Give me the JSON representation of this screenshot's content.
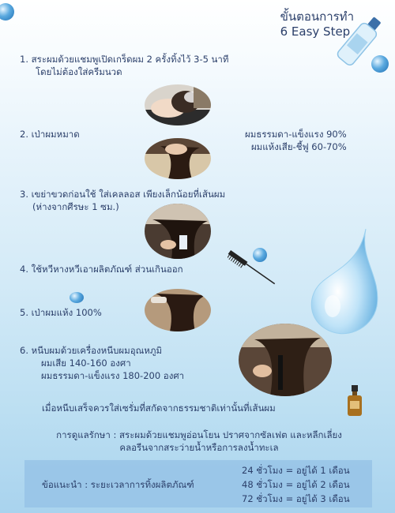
{
  "title": {
    "line1": "ขั้นตอนการทำ",
    "line2": "6 Easy Step"
  },
  "steps": [
    {
      "line1": "1. สระผมด้วยแชมพูเปิดเกร็ดผม 2 ครั้งทิ้งไว้ 3-5 นาที",
      "line2": "โดยไม่ต้องใส่ครีมนวด"
    },
    {
      "line1": "2. เป่าผมหมาด"
    },
    {
      "line1": "3. เขย่าขวดก่อนใช้ ใส่เคลลอส เพียงเล็กน้อยที่เส้นผม",
      "line2": "(ห่างจากศีรษะ 1 ซม.)"
    },
    {
      "line1": "4. ใช้หวีหางหวีเอาผลิตภัณฑ์ ส่วนเกินออก"
    },
    {
      "line1": "5. เป่าผมแห้ง 100%"
    },
    {
      "line1": "6. หนีบผมด้วยเครื่องหนีบผมอุณหภูมิ",
      "line2": "ผมเสีย 140-160 องศา",
      "line3": "ผมธรรมดา-แข็งแรง 180-200 องศา"
    }
  ],
  "dry_notes": {
    "normal": "ผมธรรมดา-แข็งแรง 90%",
    "damaged": "ผมแห้งเสีย-ชี้ฟู   60-70%"
  },
  "serum_note": "เมื่อหนีบเสร็จควรใส่เซรั่มที่สกัดจากธรรมชาติเท่านั้นที่เส้นผม",
  "care": {
    "line1": "การดูแลรักษา : สระผมด้วยแชมพูอ่อนโยน ปราศจากซัลเฟต และหลีกเลี่ยง",
    "line2": "คลอรีนจากสระว่ายน้ำหรือการลงน้ำทะเล"
  },
  "advice": {
    "label": "ข้อแนะนำ : ระยะเวลาการทิ้งผลิตภัณฑ์",
    "rows": [
      "24 ชั่วโมง = อยู่ได้ 1 เดือน",
      "48 ชั่วโมง = อยู่ได้ 2 เดือน",
      "72 ชั่วโมง = อยู่ได้ 3 เดือน"
    ]
  },
  "colors": {
    "text": "#2b3f6a",
    "accent": "#1f6fb3"
  }
}
